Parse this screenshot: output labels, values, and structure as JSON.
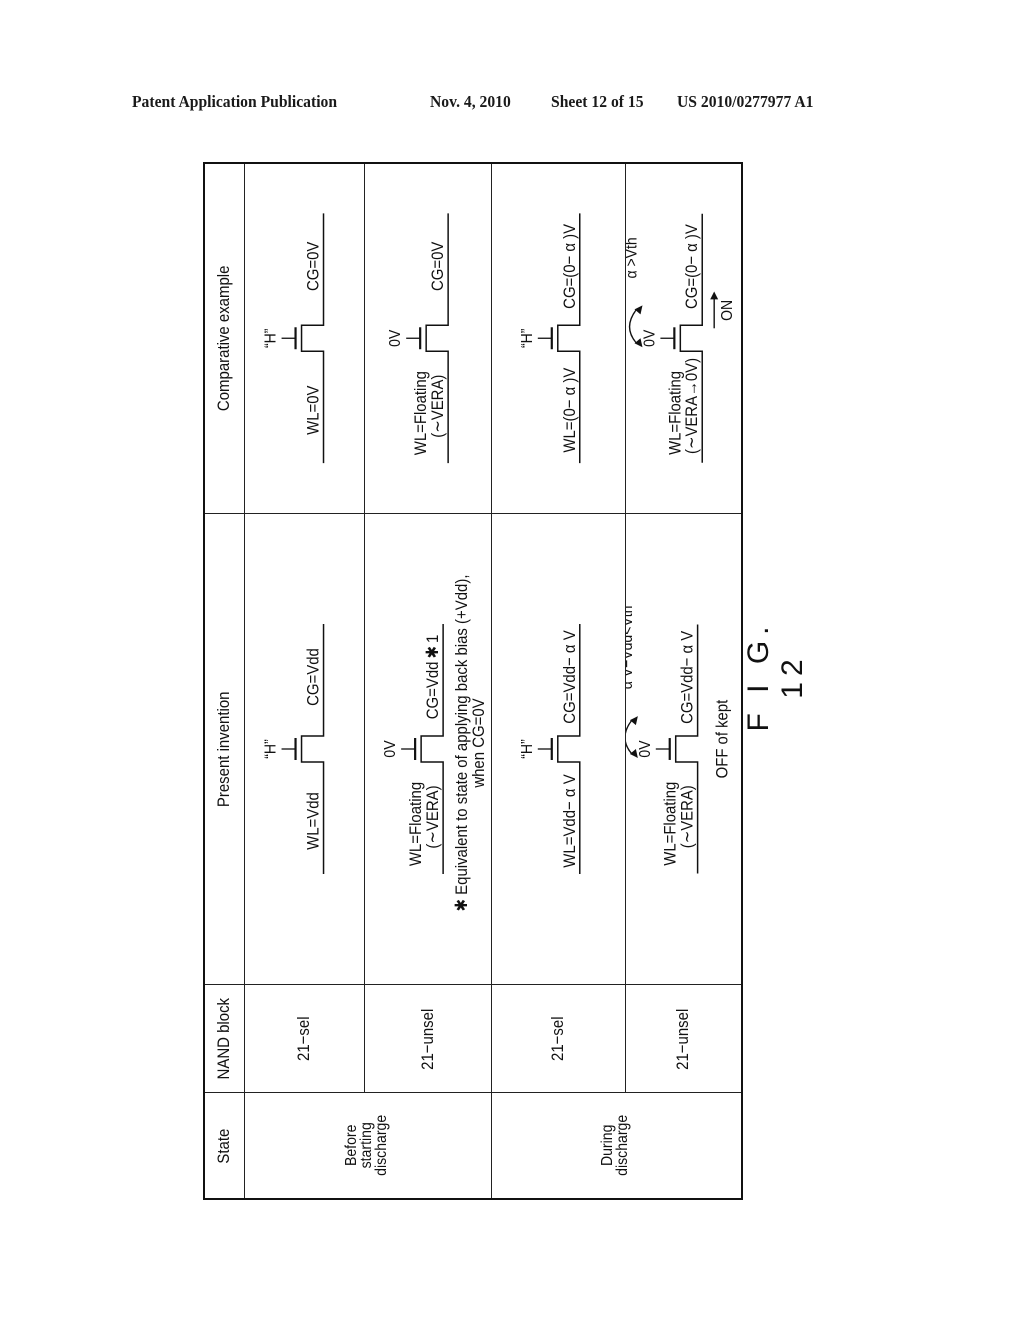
{
  "header": {
    "publication": "Patent Application Publication",
    "date": "Nov. 4, 2010",
    "sheet": "Sheet 12 of 15",
    "number": "US 2010/0277977 A1"
  },
  "table": {
    "columns": [
      "State",
      "NAND block",
      "Present invention",
      "Comparative example"
    ],
    "states": [
      {
        "label_lines": [
          "Before",
          "starting",
          "discharge"
        ]
      },
      {
        "label_lines": [
          "During",
          "discharge"
        ]
      }
    ],
    "rows": [
      {
        "nand_block": "21−sel",
        "present": {
          "gate": "“H”",
          "wl": [
            "WL=Vdd"
          ],
          "cg": "CG=Vdd",
          "note": []
        },
        "comparative": {
          "gate": "“H”",
          "wl": [
            "WL=0V"
          ],
          "cg": "CG=0V",
          "note": []
        }
      },
      {
        "nand_block": "21−unsel",
        "present": {
          "gate": "0V",
          "wl": [
            "WL=Floating",
            "(∼VERA)"
          ],
          "cg": "CG=Vdd ✱ 1",
          "note": [
            "✱ Equivalent to state of applying back bias (+Vdd),",
            "when CG=0V"
          ]
        },
        "comparative": {
          "gate": "0V",
          "wl": [
            "WL=Floating",
            "(∼VERA)"
          ],
          "cg": "CG=0V",
          "note": []
        }
      },
      {
        "nand_block": "21−sel",
        "present": {
          "gate": "“H”",
          "wl": [
            "WL=Vdd− α V"
          ],
          "cg": "CG=Vdd− α V",
          "note": []
        },
        "comparative": {
          "gate": "“H”",
          "wl": [
            "WL=(0− α )V"
          ],
          "cg": "CG=(0− α )V",
          "note": []
        }
      },
      {
        "nand_block": "21−unsel",
        "present": {
          "gate": "0V",
          "wl": [
            "WL=Floating",
            "(∼VERA)"
          ],
          "cg": "CG=Vdd− α V",
          "arrow_label": "α V−Vdd<Vth",
          "note": [
            "OFF of kept"
          ]
        },
        "comparative": {
          "gate": "0V",
          "wl": [
            "WL=Floating",
            "(∼VERA→0V)"
          ],
          "cg": "CG=(0− α )V",
          "arrow_label": "α >Vth",
          "channel_label": "ON",
          "note": []
        }
      }
    ]
  },
  "figure_label": "F I G. 12"
}
